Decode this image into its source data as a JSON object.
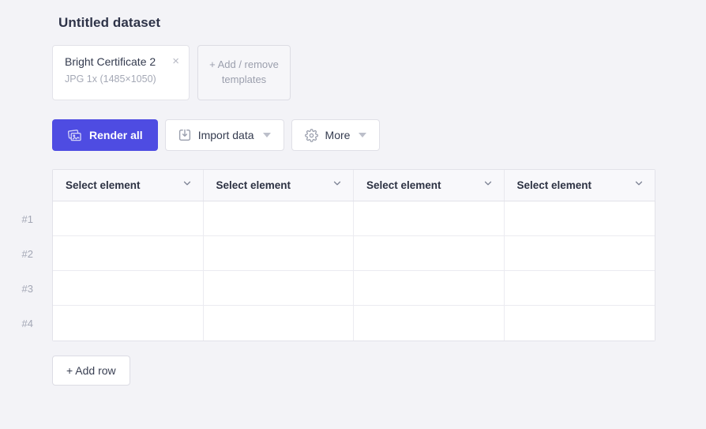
{
  "page": {
    "title": "Untitled dataset"
  },
  "templates": {
    "selected": {
      "name": "Bright Certificate 2",
      "meta": "JPG 1x (1485×1050)"
    },
    "close_glyph": "×",
    "add_remove_label": "+ Add / remove templates"
  },
  "toolbar": {
    "render_all_label": "Render all",
    "import_data_label": "Import data",
    "more_label": "More"
  },
  "table": {
    "columns": [
      {
        "header": "Select element"
      },
      {
        "header": "Select element"
      },
      {
        "header": "Select element"
      },
      {
        "header": "Select element"
      }
    ],
    "rows": [
      {
        "label": "#1",
        "cells": [
          "",
          "",
          "",
          ""
        ]
      },
      {
        "label": "#2",
        "cells": [
          "",
          "",
          "",
          ""
        ]
      },
      {
        "label": "#3",
        "cells": [
          "",
          "",
          "",
          ""
        ]
      },
      {
        "label": "#4",
        "cells": [
          "",
          "",
          "",
          ""
        ]
      }
    ]
  },
  "footer": {
    "add_row_label": "+ Add row"
  },
  "icons": {
    "render_all": "stacked-images-icon",
    "import": "import-tray-icon",
    "more": "gear-icon",
    "header_sort": "chevron-down-icon"
  },
  "colors": {
    "accent": "#4e4ce2",
    "page_background": "#f3f3f7",
    "surface": "#ffffff",
    "border": "#e2e2e9",
    "header_background": "#f8f8fb",
    "text_primary": "#2e3348",
    "text_muted": "#a3a7b5"
  }
}
